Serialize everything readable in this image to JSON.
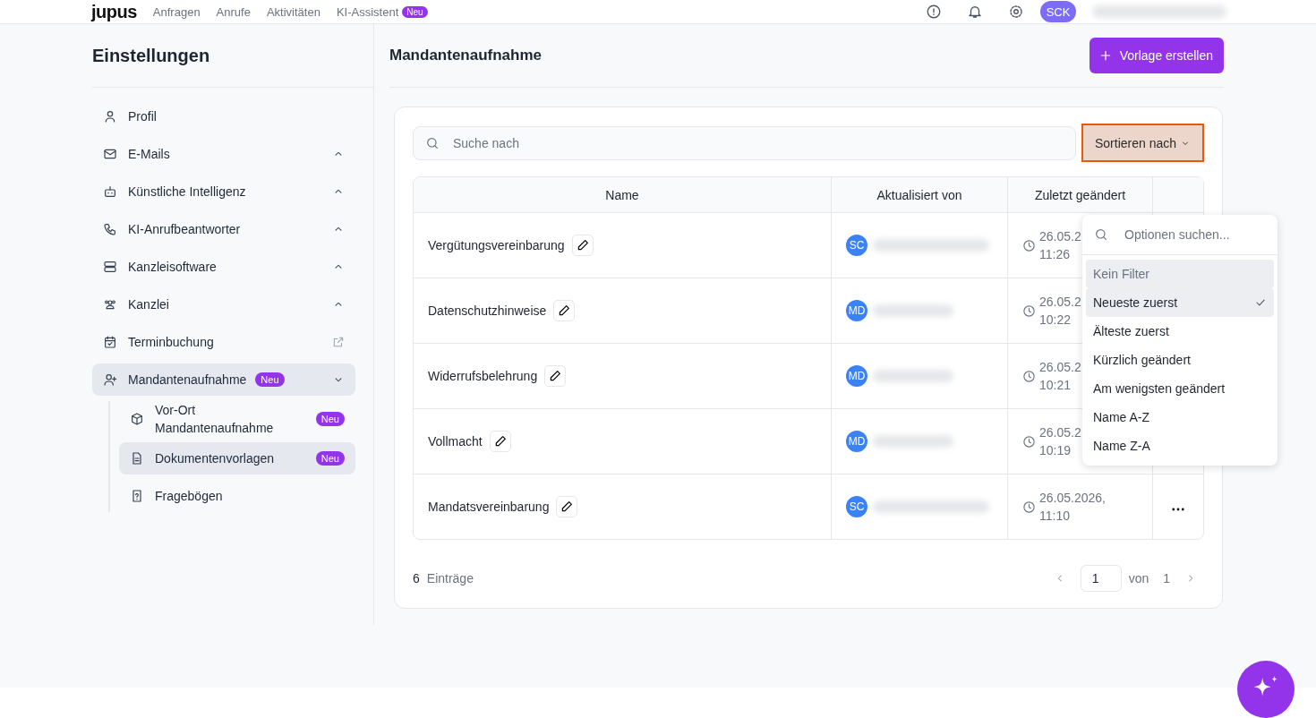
{
  "topbar": {
    "logo": "jupus",
    "nav": [
      {
        "label": "Anfragen"
      },
      {
        "label": "Anrufe"
      },
      {
        "label": "Aktivitäten"
      },
      {
        "label": "KI-Assistent",
        "badge": "Neu"
      }
    ],
    "avatar": "SCK"
  },
  "sidebar": {
    "title": "Einstellungen",
    "items": [
      {
        "label": "Profil",
        "kind": "plain",
        "selected": false
      },
      {
        "label": "E-Mails",
        "kind": "group",
        "selected": false,
        "expanded": false
      },
      {
        "label": "Künstliche Intelligenz",
        "kind": "group",
        "selected": false,
        "expanded": false
      },
      {
        "label": "KI-Anrufbeantworter",
        "kind": "group",
        "selected": false,
        "expanded": false
      },
      {
        "label": "Kanzleisoftware",
        "kind": "group",
        "selected": false,
        "expanded": false
      },
      {
        "label": "Kanzlei",
        "kind": "group",
        "selected": false,
        "expanded": false
      },
      {
        "label": "Terminbuchung",
        "kind": "external",
        "selected": false
      },
      {
        "label": "Mandantenaufnahme",
        "kind": "group",
        "badge": "Neu",
        "selected": true,
        "expanded": true,
        "children": [
          {
            "label": "Vor-Ort Mandantenaufnahme",
            "badge": "Neu",
            "selected": false
          },
          {
            "label": "Dokumentenvorlagen",
            "badge": "Neu",
            "selected": true
          },
          {
            "label": "Fragebögen",
            "selected": false
          }
        ]
      }
    ]
  },
  "content": {
    "title": "Mandantenaufnahme",
    "create_button": "Vorlage erstellen",
    "search": {
      "placeholder": "Suche nach"
    },
    "sort_button": "Sortieren nach",
    "table": {
      "columns": [
        "Name",
        "Aktualisiert von",
        "Zuletzt geändert"
      ],
      "rows": [
        {
          "name": "Vergütungsvereinbarung",
          "initials": "SC",
          "date": "26.05.2",
          "time": "11:26"
        },
        {
          "name": "Datenschutzhinweise",
          "initials": "MD",
          "date": "26.05.2",
          "time": "10:22"
        },
        {
          "name": "Widerrufsbelehrung",
          "initials": "MD",
          "date": "26.05.2",
          "time": "10:21"
        },
        {
          "name": "Vollmacht",
          "initials": "MD",
          "date": "26.05.2",
          "time": "10:19"
        },
        {
          "name": "Mandatsvereinbarung",
          "initials": "SC",
          "date": "26.05.2026,",
          "time": "11:10",
          "more_menu": true
        }
      ]
    },
    "footer": {
      "count": "6",
      "count_label": "Einträge",
      "page": "1",
      "of_label": "von",
      "pages": "1"
    }
  },
  "sort_menu": {
    "placeholder": "Optionen suchen...",
    "options": [
      {
        "label": "Kein Filter",
        "kind": "clear",
        "selected": false
      },
      {
        "label": "Neueste zuerst",
        "kind": "option",
        "selected": true
      },
      {
        "label": "Älteste zuerst",
        "kind": "option",
        "selected": false
      },
      {
        "label": "Kürzlich geändert",
        "kind": "option",
        "selected": false
      },
      {
        "label": "Am wenigsten geändert",
        "kind": "option",
        "selected": false
      },
      {
        "label": "Name A-Z",
        "kind": "option",
        "selected": false
      },
      {
        "label": "Name Z-A",
        "kind": "option",
        "selected": false
      }
    ]
  }
}
